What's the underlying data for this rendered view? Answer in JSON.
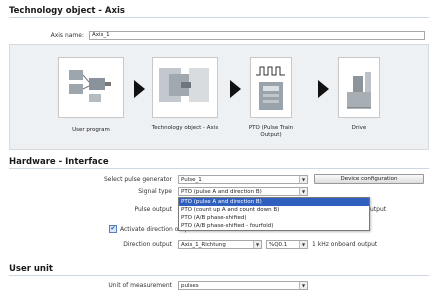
{
  "technology_object": {
    "title": "Technology object - Axis",
    "axis_name_label": "Axis name:",
    "axis_name_value": "Axis_1",
    "diagram": {
      "user_program": "User program",
      "tech_object": "Technology object - Axis",
      "pto": "PTO (Pulse Train Output)",
      "drive": "Drive"
    }
  },
  "hardware_interface": {
    "title": "Hardware - Interface",
    "pulse_generator_label": "Select pulse generator",
    "pulse_generator_value": "Pulse_1",
    "device_config_button": "Device configuration",
    "signal_type_label": "Signal type",
    "signal_type_value": "PTO (pulse A and direction B)",
    "signal_type_options": [
      "PTO (pulse A and direction B)",
      "PTO (count up A and count down B)",
      "PTO (A/B phase-shifted)",
      "PTO (A/B phase-shifted - fourfold)"
    ],
    "selected_option_index": 0,
    "pulse_output_label": "Pulse output",
    "pulse_output_suffix": "utput",
    "activate_direction_label": "Activate direction outpu",
    "activate_direction_checked": true,
    "direction_output_label": "Direction output",
    "direction_output_value": "Axis_1_Richtung",
    "direction_address_value": "%Q0.1",
    "direction_output_suffix": "1 kHz onboard output"
  },
  "user_unit": {
    "title": "User unit",
    "unit_label": "Unit of measurement",
    "unit_value": "pulses"
  }
}
